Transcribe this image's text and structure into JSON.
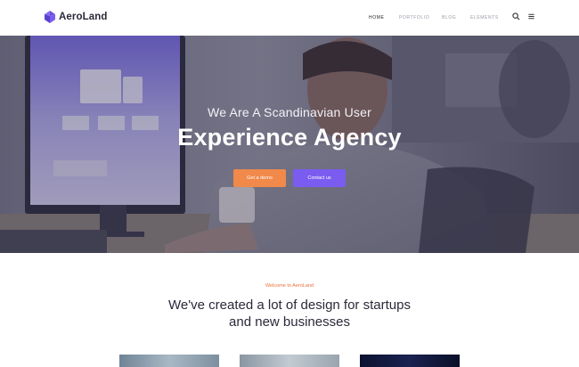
{
  "header": {
    "logo_text": "AeroLand",
    "nav": [
      {
        "label": "HOME",
        "active": true
      },
      {
        "label": "PORTFOLIO",
        "active": false
      },
      {
        "label": "BLOG",
        "active": false
      },
      {
        "label": "ELEMENTS",
        "active": false
      }
    ],
    "icons": [
      "search-icon",
      "menu-icon"
    ]
  },
  "hero": {
    "subtitle": "We Are A Scandinavian User",
    "title": "Experience Agency",
    "buttons": [
      {
        "label": "Get a demo",
        "color": "#f0894a"
      },
      {
        "label": "Contact us",
        "color": "#7a5cf0"
      }
    ]
  },
  "section": {
    "eyebrow": "Welcome to AeroLand",
    "title_line1": "We've created a lot of design for startups",
    "title_line2": "and new businesses"
  },
  "colors": {
    "accent_orange": "#f0894a",
    "accent_purple": "#7a5cf0",
    "logo_purple": "#6b4fe0",
    "eyebrow": "#e8713a"
  }
}
